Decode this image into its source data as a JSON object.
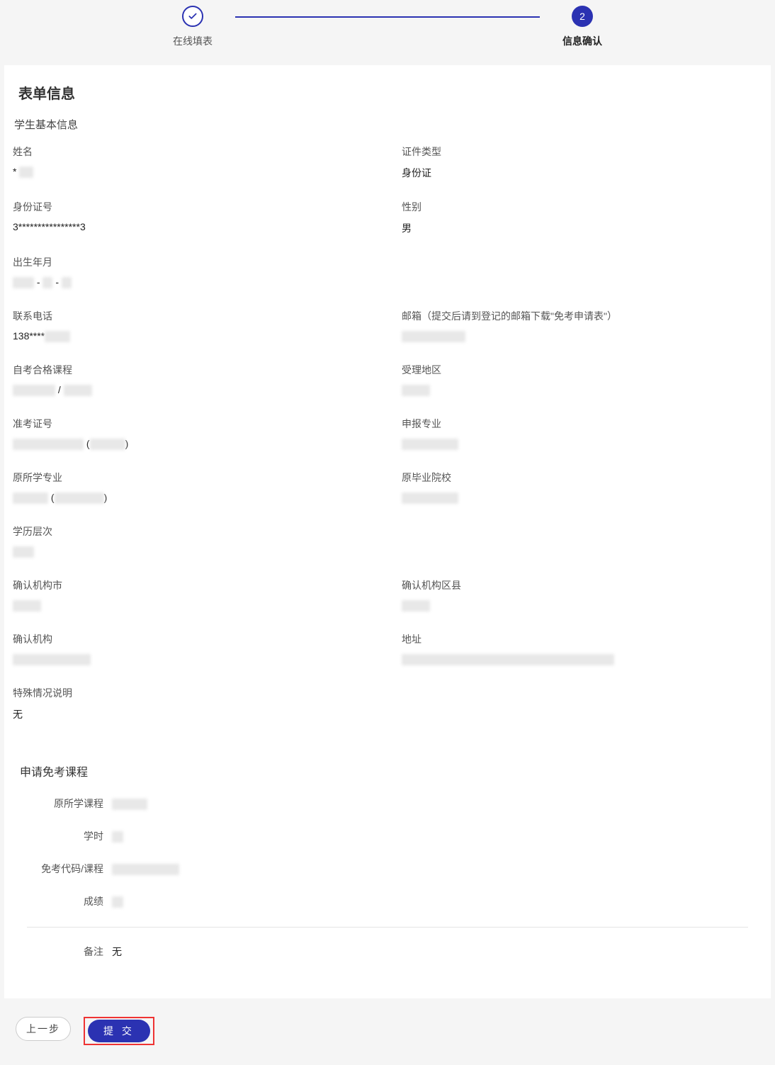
{
  "stepper": {
    "step1_label": "在线填表",
    "step2_number": "2",
    "step2_label": "信息确认"
  },
  "form": {
    "title": "表单信息",
    "section_basic": "学生基本信息",
    "fields": {
      "name_label": "姓名",
      "name_value": "*",
      "id_type_label": "证件类型",
      "id_type_value": "身份证",
      "id_no_label": "身份证号",
      "id_no_value": "3****************3",
      "gender_label": "性别",
      "gender_value": "男",
      "birth_label": "出生年月",
      "birth_value": "",
      "phone_label": "联系电话",
      "phone_value": "138****",
      "email_label": "邮箱（提交后请到登记的邮箱下载\"免考申请表\"）",
      "email_value": "",
      "exam_pass_label": "自考合格课程",
      "exam_pass_value": "",
      "accept_area_label": "受理地区",
      "accept_area_value": "",
      "ticket_label": "准考证号",
      "ticket_value": "",
      "apply_major_label": "申报专业",
      "apply_major_value": "",
      "orig_major_label": "原所学专业",
      "orig_major_value": "",
      "orig_school_label": "原毕业院校",
      "orig_school_value": "",
      "edu_level_label": "学历层次",
      "edu_level_value": "",
      "confirm_city_label": "确认机构市",
      "confirm_city_value": "",
      "confirm_county_label": "确认机构区县",
      "confirm_county_value": "",
      "confirm_org_label": "确认机构",
      "confirm_org_value": "",
      "address_label": "地址",
      "address_value": "",
      "special_label": "特殊情况说明",
      "special_value": "无"
    },
    "course_section": {
      "title": "申请免考课程",
      "orig_course_label": "原所学课程",
      "orig_course_value": "",
      "hours_label": "学时",
      "hours_value": "",
      "exempt_code_label": "免考代码/课程",
      "exempt_code_value": "",
      "score_label": "成绩",
      "score_value": "",
      "remark_label": "备注",
      "remark_value": "无"
    }
  },
  "footer": {
    "prev": "上一步",
    "submit": "提 交"
  }
}
